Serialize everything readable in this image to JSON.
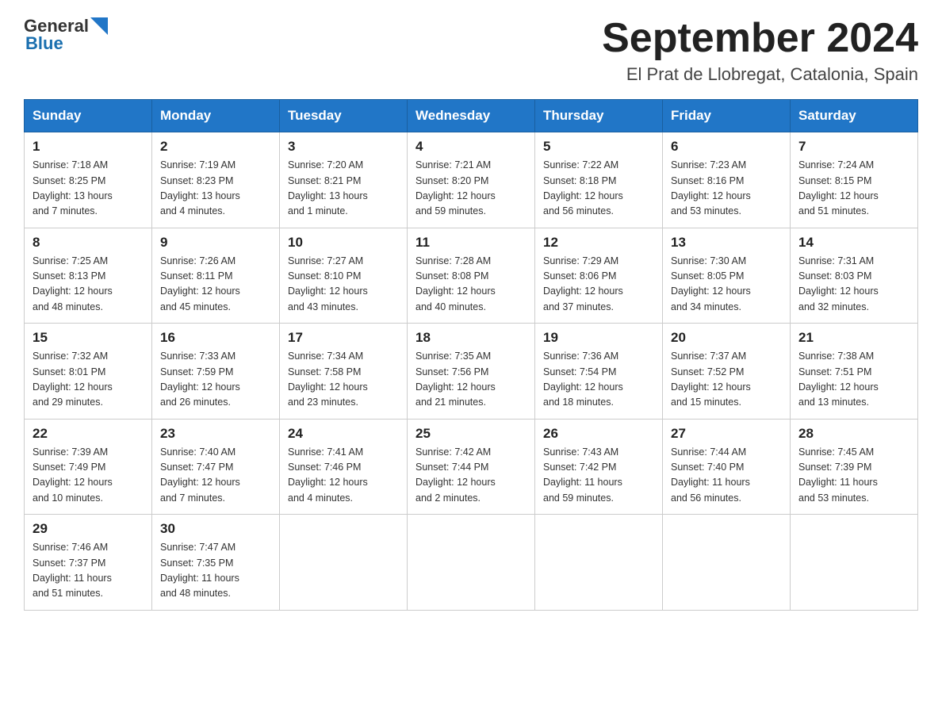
{
  "header": {
    "logo_general": "General",
    "logo_blue": "Blue",
    "month_title": "September 2024",
    "location": "El Prat de Llobregat, Catalonia, Spain"
  },
  "columns": [
    "Sunday",
    "Monday",
    "Tuesday",
    "Wednesday",
    "Thursday",
    "Friday",
    "Saturday"
  ],
  "weeks": [
    [
      {
        "day": "1",
        "info": "Sunrise: 7:18 AM\nSunset: 8:25 PM\nDaylight: 13 hours\nand 7 minutes."
      },
      {
        "day": "2",
        "info": "Sunrise: 7:19 AM\nSunset: 8:23 PM\nDaylight: 13 hours\nand 4 minutes."
      },
      {
        "day": "3",
        "info": "Sunrise: 7:20 AM\nSunset: 8:21 PM\nDaylight: 13 hours\nand 1 minute."
      },
      {
        "day": "4",
        "info": "Sunrise: 7:21 AM\nSunset: 8:20 PM\nDaylight: 12 hours\nand 59 minutes."
      },
      {
        "day": "5",
        "info": "Sunrise: 7:22 AM\nSunset: 8:18 PM\nDaylight: 12 hours\nand 56 minutes."
      },
      {
        "day": "6",
        "info": "Sunrise: 7:23 AM\nSunset: 8:16 PM\nDaylight: 12 hours\nand 53 minutes."
      },
      {
        "day": "7",
        "info": "Sunrise: 7:24 AM\nSunset: 8:15 PM\nDaylight: 12 hours\nand 51 minutes."
      }
    ],
    [
      {
        "day": "8",
        "info": "Sunrise: 7:25 AM\nSunset: 8:13 PM\nDaylight: 12 hours\nand 48 minutes."
      },
      {
        "day": "9",
        "info": "Sunrise: 7:26 AM\nSunset: 8:11 PM\nDaylight: 12 hours\nand 45 minutes."
      },
      {
        "day": "10",
        "info": "Sunrise: 7:27 AM\nSunset: 8:10 PM\nDaylight: 12 hours\nand 43 minutes."
      },
      {
        "day": "11",
        "info": "Sunrise: 7:28 AM\nSunset: 8:08 PM\nDaylight: 12 hours\nand 40 minutes."
      },
      {
        "day": "12",
        "info": "Sunrise: 7:29 AM\nSunset: 8:06 PM\nDaylight: 12 hours\nand 37 minutes."
      },
      {
        "day": "13",
        "info": "Sunrise: 7:30 AM\nSunset: 8:05 PM\nDaylight: 12 hours\nand 34 minutes."
      },
      {
        "day": "14",
        "info": "Sunrise: 7:31 AM\nSunset: 8:03 PM\nDaylight: 12 hours\nand 32 minutes."
      }
    ],
    [
      {
        "day": "15",
        "info": "Sunrise: 7:32 AM\nSunset: 8:01 PM\nDaylight: 12 hours\nand 29 minutes."
      },
      {
        "day": "16",
        "info": "Sunrise: 7:33 AM\nSunset: 7:59 PM\nDaylight: 12 hours\nand 26 minutes."
      },
      {
        "day": "17",
        "info": "Sunrise: 7:34 AM\nSunset: 7:58 PM\nDaylight: 12 hours\nand 23 minutes."
      },
      {
        "day": "18",
        "info": "Sunrise: 7:35 AM\nSunset: 7:56 PM\nDaylight: 12 hours\nand 21 minutes."
      },
      {
        "day": "19",
        "info": "Sunrise: 7:36 AM\nSunset: 7:54 PM\nDaylight: 12 hours\nand 18 minutes."
      },
      {
        "day": "20",
        "info": "Sunrise: 7:37 AM\nSunset: 7:52 PM\nDaylight: 12 hours\nand 15 minutes."
      },
      {
        "day": "21",
        "info": "Sunrise: 7:38 AM\nSunset: 7:51 PM\nDaylight: 12 hours\nand 13 minutes."
      }
    ],
    [
      {
        "day": "22",
        "info": "Sunrise: 7:39 AM\nSunset: 7:49 PM\nDaylight: 12 hours\nand 10 minutes."
      },
      {
        "day": "23",
        "info": "Sunrise: 7:40 AM\nSunset: 7:47 PM\nDaylight: 12 hours\nand 7 minutes."
      },
      {
        "day": "24",
        "info": "Sunrise: 7:41 AM\nSunset: 7:46 PM\nDaylight: 12 hours\nand 4 minutes."
      },
      {
        "day": "25",
        "info": "Sunrise: 7:42 AM\nSunset: 7:44 PM\nDaylight: 12 hours\nand 2 minutes."
      },
      {
        "day": "26",
        "info": "Sunrise: 7:43 AM\nSunset: 7:42 PM\nDaylight: 11 hours\nand 59 minutes."
      },
      {
        "day": "27",
        "info": "Sunrise: 7:44 AM\nSunset: 7:40 PM\nDaylight: 11 hours\nand 56 minutes."
      },
      {
        "day": "28",
        "info": "Sunrise: 7:45 AM\nSunset: 7:39 PM\nDaylight: 11 hours\nand 53 minutes."
      }
    ],
    [
      {
        "day": "29",
        "info": "Sunrise: 7:46 AM\nSunset: 7:37 PM\nDaylight: 11 hours\nand 51 minutes."
      },
      {
        "day": "30",
        "info": "Sunrise: 7:47 AM\nSunset: 7:35 PM\nDaylight: 11 hours\nand 48 minutes."
      },
      {
        "day": "",
        "info": ""
      },
      {
        "day": "",
        "info": ""
      },
      {
        "day": "",
        "info": ""
      },
      {
        "day": "",
        "info": ""
      },
      {
        "day": "",
        "info": ""
      }
    ]
  ]
}
